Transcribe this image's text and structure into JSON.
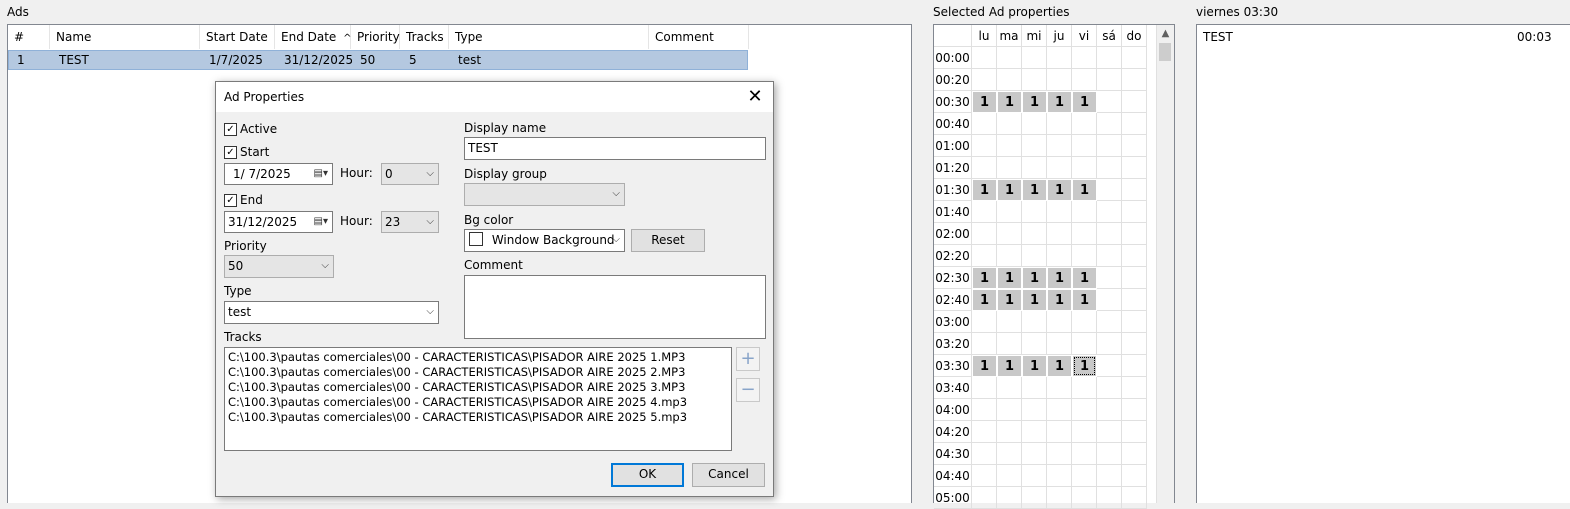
{
  "ads_panel": {
    "title": "Ads",
    "columns": [
      "#",
      "Name",
      "Start Date",
      "End Date",
      "Priority",
      "Tracks",
      "Type",
      "Comment"
    ],
    "sort_indicator": "^",
    "rows": [
      {
        "num": "1",
        "name": "TEST",
        "start": "1/7/2025",
        "end": "31/12/2025",
        "priority": "50",
        "tracks": "5",
        "type": "test",
        "comment": ""
      }
    ]
  },
  "schedule_panel": {
    "title": "Selected Ad properties",
    "days": [
      "lu",
      "ma",
      "mi",
      "ju",
      "vi",
      "sá",
      "do"
    ],
    "times": [
      "00:00",
      "00:20",
      "00:30",
      "00:40",
      "01:00",
      "01:20",
      "01:30",
      "01:40",
      "02:00",
      "02:20",
      "02:30",
      "02:40",
      "03:00",
      "03:20",
      "03:30",
      "03:40",
      "04:00",
      "04:20",
      "04:30",
      "04:40",
      "05:00"
    ],
    "active_rows": [
      "00:30",
      "01:30",
      "02:30",
      "02:40",
      "03:30"
    ],
    "cell_value": "1",
    "active_days": 5,
    "focused": {
      "time": "03:30",
      "day": "vi"
    }
  },
  "day_panel": {
    "title": "viernes 03:30",
    "items": [
      {
        "name": "TEST",
        "duration": "00:03"
      }
    ]
  },
  "dialog": {
    "title": "Ad Properties",
    "close_glyph": "✕",
    "active_label": "Active",
    "start_label": "Start",
    "start_date": "1/  7/2025",
    "hour_label": "Hour:",
    "start_hour": "0",
    "end_label": "End",
    "end_date": "31/12/2025",
    "end_hour": "23",
    "priority_label": "Priority",
    "priority": "50",
    "type_label": "Type",
    "type": "test",
    "display_name_label": "Display name",
    "display_name": "TEST",
    "display_group_label": "Display group",
    "display_group": "",
    "bg_color_label": "Bg color",
    "bg_color": "Window Background",
    "reset_label": "Reset",
    "comment_label": "Comment",
    "comment": "",
    "tracks_label": "Tracks",
    "tracks": [
      "C:\\100.3\\pautas comerciales\\00 - CARACTERISTICAS\\PISADOR AIRE 2025 1.MP3",
      "C:\\100.3\\pautas comerciales\\00 - CARACTERISTICAS\\PISADOR AIRE 2025 2.MP3",
      "C:\\100.3\\pautas comerciales\\00 - CARACTERISTICAS\\PISADOR AIRE 2025 3.MP3",
      "C:\\100.3\\pautas comerciales\\00 - CARACTERISTICAS\\PISADOR AIRE 2025 4.mp3",
      "C:\\100.3\\pautas comerciales\\00 - CARACTERISTICAS\\PISADOR AIRE 2025 5.mp3"
    ],
    "add_glyph": "+",
    "remove_glyph": "−",
    "ok_label": "OK",
    "cancel_label": "Cancel"
  },
  "colors": {
    "selection": "#b4c8e0",
    "active_cell": "#c8c8c8",
    "default_button_border": "#0078d7"
  }
}
